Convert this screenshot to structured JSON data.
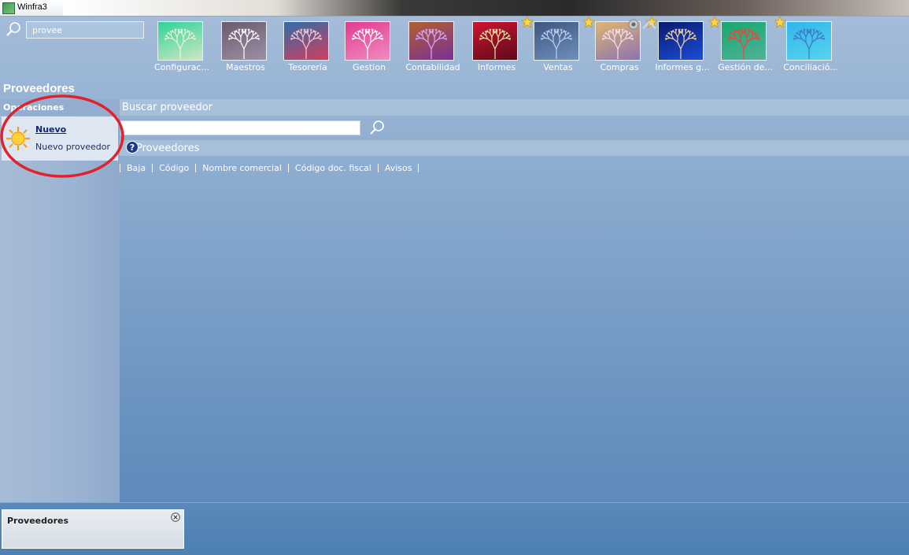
{
  "window": {
    "title": "Winfra3"
  },
  "global_search": {
    "value": "provee"
  },
  "modules": [
    {
      "label": "Configurac...",
      "colors": [
        "#2fd39a",
        "#cfe7c2"
      ],
      "tree": "#e9f3d8",
      "star": false
    },
    {
      "label": "Maestros",
      "colors": [
        "#6c5a6e",
        "#9c8fa5"
      ],
      "tree": "#ffffff",
      "star": false
    },
    {
      "label": "Tesorería",
      "colors": [
        "#2f6ea8",
        "#d23d5e"
      ],
      "tree": "#f7c9d4",
      "star": false
    },
    {
      "label": "Gestion",
      "colors": [
        "#e23a8e",
        "#f08cc0"
      ],
      "tree": "#ffffff",
      "star": false
    },
    {
      "label": "Contabilidad",
      "colors": [
        "#b0602d",
        "#7a2f9a"
      ],
      "tree": "#d5a8ff",
      "star": false
    },
    {
      "label": "Informes",
      "colors": [
        "#cf1430",
        "#5c0a1a"
      ],
      "tree": "#e7e7a8",
      "star": false
    },
    {
      "label": "Ventas",
      "colors": [
        "#3d5680",
        "#6f8fbc"
      ],
      "tree": "#bcd0ef",
      "star": true
    },
    {
      "label": "Compras",
      "colors": [
        "#e0b56f",
        "#8a73b2"
      ],
      "tree": "#f6dcf1",
      "star": true
    },
    {
      "label": "Informes g...",
      "colors": [
        "#0a1a6e",
        "#1c4dd8"
      ],
      "tree": "#f3d3a9",
      "star": true
    },
    {
      "label": "Gestión de...",
      "colors": [
        "#18a86b",
        "#4fb29a"
      ],
      "tree": "#ff3b3b",
      "star": true
    },
    {
      "label": "Conciliació...",
      "colors": [
        "#2fb7e8",
        "#58d3f0"
      ],
      "tree": "#3f74c9",
      "star": true
    }
  ],
  "page": {
    "title": "Proveedores"
  },
  "left_panel": {
    "header": "Operaciones",
    "new_label": "Nuevo",
    "new_desc": "Nuevo proveedor"
  },
  "search": {
    "header": "Buscar proveedor",
    "value": ""
  },
  "list": {
    "header": "Proveedores",
    "columns": [
      "Baja",
      "Código",
      "Nombre comercial",
      "Código doc. fiscal",
      "Avisos"
    ]
  },
  "tabs": [
    {
      "label": "Proveedores"
    }
  ],
  "colors": {
    "highlight": "#e0232b",
    "link": "#102a70"
  }
}
